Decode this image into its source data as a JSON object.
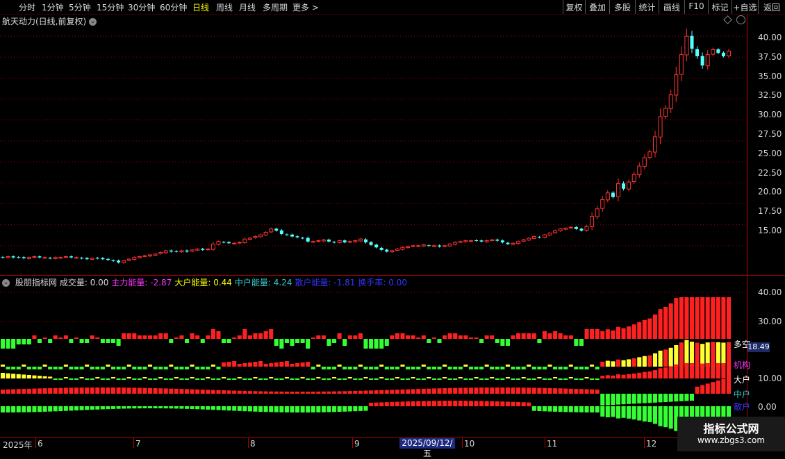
{
  "toolbar": {
    "periods": [
      {
        "label": "分时"
      },
      {
        "label": "1分钟"
      },
      {
        "label": "5分钟"
      },
      {
        "label": "15分钟"
      },
      {
        "label": "30分钟"
      },
      {
        "label": "60分钟"
      },
      {
        "label": "日线"
      },
      {
        "label": "周线"
      },
      {
        "label": "月线"
      },
      {
        "label": "多周期"
      },
      {
        "label": "更多 >"
      }
    ],
    "active_period": "日线",
    "right_buttons": [
      {
        "label": "复权"
      },
      {
        "label": "叠加"
      },
      {
        "label": "多股"
      },
      {
        "label": "统计"
      },
      {
        "label": "画线"
      },
      {
        "label": "F10"
      },
      {
        "label": "标记"
      },
      {
        "label": "+自选"
      },
      {
        "label": "返回"
      }
    ]
  },
  "main_chart": {
    "title": "航天动力(日线,前复权)",
    "y_ticks": [
      "40.00",
      "37.50",
      "35.00",
      "32.50",
      "30.00",
      "27.50",
      "25.00",
      "22.50",
      "20.00",
      "17.50",
      "15.00"
    ]
  },
  "indicator": {
    "legend": [
      {
        "text": "股朋指标网",
        "color": "#d8d8d8"
      },
      {
        "text": "成交量: 0.00",
        "color": "#d8d8d8"
      },
      {
        "text": "主力能量: -2.87",
        "color": "#ff33ff"
      },
      {
        "text": "大户能量: 0.44",
        "color": "#ffff00"
      },
      {
        "text": "中户能量: 4.24",
        "color": "#33cccc"
      },
      {
        "text": "散户能量: -1.81",
        "color": "#3333ff"
      },
      {
        "text": "换手率: 0.00",
        "color": "#3333ff"
      }
    ],
    "y_ticks": [
      "40.00",
      "30.00",
      "10.00",
      "0.00"
    ],
    "line_labels": [
      {
        "text": "多空",
        "color": "#ffffff"
      },
      {
        "text": "机构",
        "color": "#ff33ff"
      },
      {
        "text": "大户",
        "color": "#ffffff"
      },
      {
        "text": "中户",
        "color": "#33cccc"
      },
      {
        "text": "散户",
        "color": "#3333ff"
      }
    ],
    "value_badge": "18.49"
  },
  "x_axis": {
    "labels": [
      "2025年",
      "6",
      "7",
      "8",
      "9",
      "10",
      "11",
      "12"
    ],
    "cursor_date": "2025/09/12/五"
  },
  "watermark": {
    "title": "指标公式网",
    "url": "www.zbgs3.com"
  },
  "colors": {
    "up": "#ff3333",
    "down": "#54ffff",
    "green": "#33ff33",
    "yellow": "#ffff33",
    "red": "#ff2020",
    "grid": "#a00000"
  },
  "chart_data": {
    "type": "candlestick",
    "y_axis_range": [
      13.0,
      41.5
    ],
    "closes": [
      13.6,
      13.7,
      13.6,
      13.6,
      13.5,
      13.6,
      13.7,
      13.6,
      13.6,
      13.5,
      13.6,
      13.6,
      13.7,
      13.6,
      13.6,
      13.5,
      13.4,
      13.5,
      13.5,
      13.4,
      13.3,
      13.2,
      13.0,
      13.2,
      13.4,
      13.6,
      13.7,
      13.8,
      13.9,
      14.0,
      14.2,
      14.4,
      14.3,
      14.3,
      14.4,
      14.3,
      14.5,
      14.6,
      14.5,
      14.6,
      15.2,
      15.5,
      15.4,
      15.3,
      15.3,
      15.4,
      15.8,
      15.9,
      16.1,
      16.3,
      16.6,
      17.0,
      16.8,
      16.4,
      16.3,
      16.1,
      16.0,
      15.9,
      15.5,
      15.5,
      15.6,
      15.7,
      15.5,
      15.4,
      15.6,
      15.4,
      15.5,
      15.6,
      15.8,
      15.4,
      15.1,
      14.8,
      14.5,
      14.3,
      14.4,
      14.6,
      14.8,
      14.9,
      15.0,
      15.0,
      15.1,
      15.0,
      15.0,
      14.9,
      15.0,
      15.2,
      15.4,
      15.5,
      15.6,
      15.6,
      15.6,
      15.5,
      15.6,
      15.7,
      15.6,
      15.4,
      15.2,
      15.3,
      15.5,
      15.7,
      15.9,
      16.1,
      16.0,
      16.3,
      16.5,
      16.8,
      17.0,
      17.1,
      17.2,
      17.0,
      16.8,
      17.3,
      18.5,
      19.4,
      20.5,
      21.3,
      20.8,
      22.4,
      21.8,
      22.6,
      23.5,
      24.5,
      25.5,
      26.2,
      28.0,
      30.4,
      31.4,
      33.0,
      35.4,
      37.8,
      40.0,
      38.5,
      37.6,
      36.5,
      37.8,
      38.4,
      38.0,
      37.6,
      38.2
    ]
  }
}
